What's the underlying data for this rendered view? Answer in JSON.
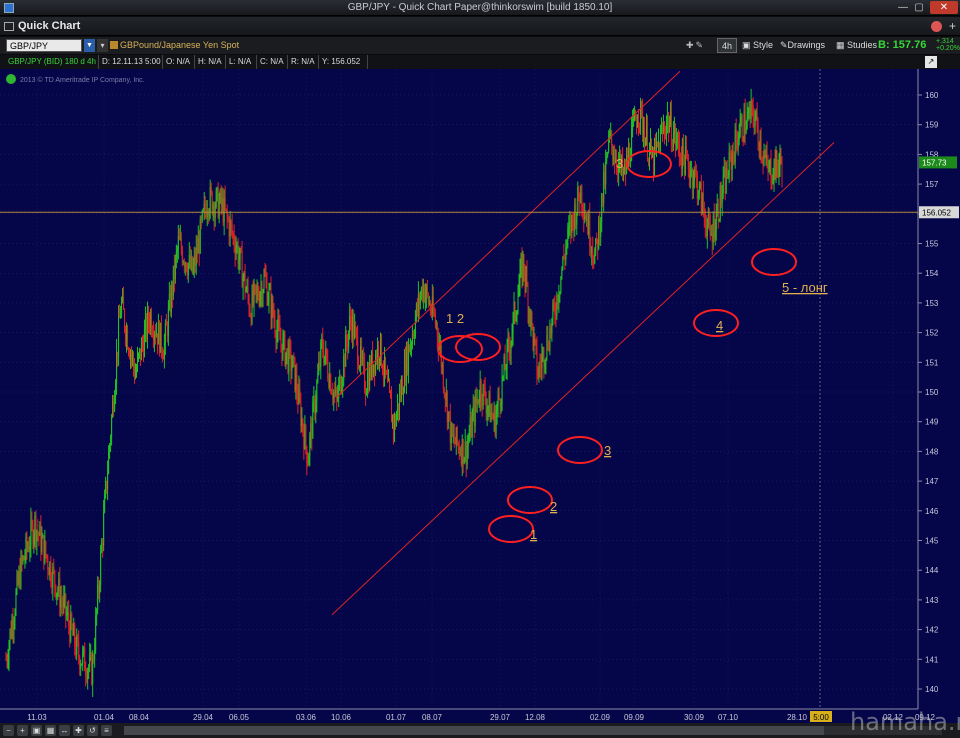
{
  "window": {
    "title": "GBP/JPY - Quick Chart Paper@thinkorswim [build 1850.10]"
  },
  "panel": {
    "title": "Quick Chart"
  },
  "toolbar": {
    "symbol": "GBP/JPY",
    "description": "GBPound/Japanese Yen Spot",
    "period": "4h",
    "style_label": "Style",
    "drawings_label": "Drawings",
    "studies_label": "Studies",
    "bid_price": "B: 157.76",
    "bid_change_abs": "+.314",
    "bid_change_pct": "+0.20%"
  },
  "infobar": {
    "symbol_label": "GBP/JPY (BID) 180 d 4h",
    "date": "D: 12.11.13 5:00",
    "open": "O: N/A",
    "high": "H: N/A",
    "low": "L: N/A",
    "close": "C: N/A",
    "range": "R: N/A",
    "cursor_y": "Y: 156.052"
  },
  "chart_copyright": "2013 © TD Ameritrade IP Company, Inc.",
  "price_axis": {
    "ticks": [
      "160",
      "159",
      "158",
      "157",
      "156",
      "155",
      "154",
      "153",
      "152",
      "151",
      "150",
      "149",
      "148",
      "147",
      "146",
      "145",
      "144",
      "143",
      "142",
      "141",
      "140"
    ],
    "last_price_label": "157.73",
    "cursor_price_label": "156.052"
  },
  "time_axis": {
    "ticks": [
      "11.03",
      "01.04",
      "08.04",
      "29.04",
      "06.05",
      "03.06",
      "10.06",
      "01.07",
      "08.07",
      "29.07",
      "12.08",
      "02.09",
      "09.09",
      "30.09",
      "07.10",
      "28.10",
      "02.12",
      "09.12"
    ],
    "cursor_time_label": "5:00"
  },
  "annotations": {
    "wave_labels": [
      "1 2",
      "3",
      "3",
      "4",
      "2",
      "1"
    ],
    "signal_text": "5 - лонг"
  },
  "colors": {
    "background": "#05054a",
    "up_bar": "#22c322",
    "down_bar": "#e02424",
    "channel": "#e02424",
    "annotation_text": "#e0b050",
    "grid": "#2a2a7a"
  },
  "chart_data": {
    "type": "candlestick",
    "title": "GBP/JPY (BID) 180 d 4h",
    "ylim": [
      140,
      160.8
    ],
    "price_keypoints": [
      {
        "x": "11.03",
        "y": 141.0
      },
      {
        "x": "",
        "y": 144.0
      },
      {
        "x": "",
        "y": 145.6
      },
      {
        "x": "",
        "y": 144.2
      },
      {
        "x": "",
        "y": 142.8
      },
      {
        "x": "",
        "y": 141.2
      },
      {
        "x": "01.04",
        "y": 140.6
      },
      {
        "x": "",
        "y": 147.0
      },
      {
        "x": "08.04",
        "y": 153.0
      },
      {
        "x": "",
        "y": 150.6
      },
      {
        "x": "",
        "y": 152.6
      },
      {
        "x": "",
        "y": 151.5
      },
      {
        "x": "29.04",
        "y": 155.0
      },
      {
        "x": "",
        "y": 154.0
      },
      {
        "x": "",
        "y": 156.5
      },
      {
        "x": "06.05",
        "y": 156.3
      },
      {
        "x": "",
        "y": 155.0
      },
      {
        "x": "",
        "y": 152.8
      },
      {
        "x": "",
        "y": 153.8
      },
      {
        "x": "",
        "y": 151.8
      },
      {
        "x": "03.06",
        "y": 150.8
      },
      {
        "x": "10.06",
        "y": 147.8
      },
      {
        "x": "",
        "y": 151.6
      },
      {
        "x": "",
        "y": 149.6
      },
      {
        "x": "01.07",
        "y": 152.5
      },
      {
        "x": "",
        "y": 150.3
      },
      {
        "x": "08.07",
        "y": 151.6
      },
      {
        "x": "",
        "y": 148.8
      },
      {
        "x": "",
        "y": 151.4
      },
      {
        "x": "",
        "y": 153.6
      },
      {
        "x": "",
        "y": 152.2
      },
      {
        "x": "",
        "y": 148.4
      },
      {
        "x": "29.07",
        "y": 148.0
      },
      {
        "x": "",
        "y": 150.2
      },
      {
        "x": "12.08",
        "y": 149.0
      },
      {
        "x": "",
        "y": 151.5
      },
      {
        "x": "",
        "y": 154.4
      },
      {
        "x": "",
        "y": 150.6
      },
      {
        "x": "",
        "y": 152.3
      },
      {
        "x": "02.09",
        "y": 155.0
      },
      {
        "x": "",
        "y": 156.8
      },
      {
        "x": "",
        "y": 154.5
      },
      {
        "x": "",
        "y": 158.5
      },
      {
        "x": "09.09",
        "y": 157.2
      },
      {
        "x": "",
        "y": 159.6
      },
      {
        "x": "",
        "y": 157.7
      },
      {
        "x": "",
        "y": 159.2
      },
      {
        "x": "30.09",
        "y": 158.0
      },
      {
        "x": "",
        "y": 157.2
      },
      {
        "x": "",
        "y": 155.2
      },
      {
        "x": "07.10",
        "y": 157.0
      },
      {
        "x": "",
        "y": 158.8
      },
      {
        "x": "",
        "y": 159.4
      },
      {
        "x": "",
        "y": 157.4
      },
      {
        "x": "28.10",
        "y": 157.73
      }
    ],
    "channel": {
      "lower": [
        {
          "x": "10.06",
          "y": 142.5
        },
        {
          "x": "28.10",
          "y": 158.4
        }
      ],
      "upper": [
        {
          "x": "10.06",
          "y": 149.8
        },
        {
          "x": "09.09",
          "y": 160.8
        }
      ]
    },
    "horizontal_line": {
      "y": 156.052
    },
    "vertical_line": {
      "x": "5:00"
    }
  }
}
